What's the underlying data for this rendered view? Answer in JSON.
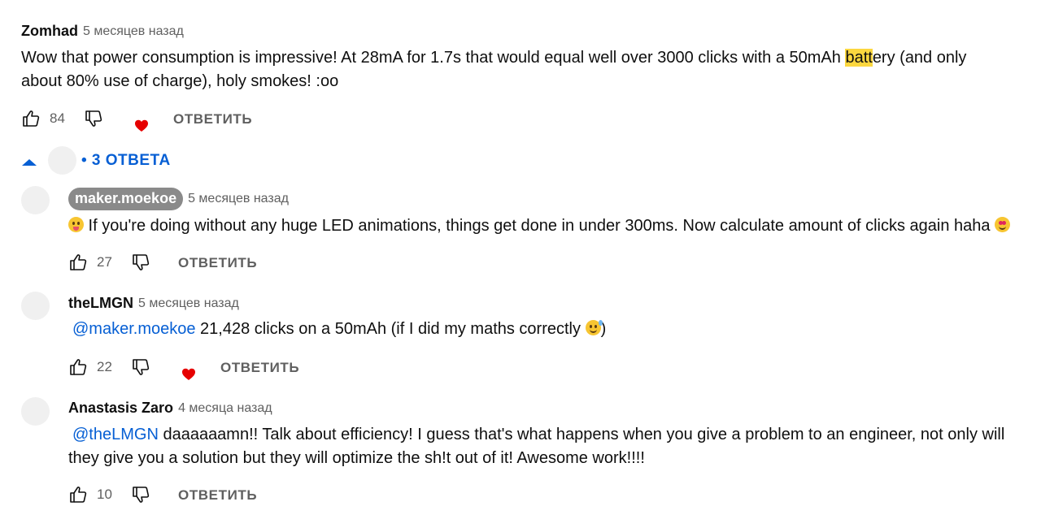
{
  "comments": [
    {
      "author": "Zomhad",
      "time": "5 месяцев назад",
      "text_pre": "Wow that power consumption is impressive! At 28mA for 1.7s that would equal well over 3000 clicks with a 50mAh ",
      "text_hl": "batt",
      "text_post": "ery (and only about 80% use of charge), holy smokes! :oo",
      "likes": "84",
      "reply_label": "ОТВЕТИТЬ",
      "creator_heart": true
    }
  ],
  "replies_toggle": {
    "label": "• 3 ОТВЕТА"
  },
  "replies": [
    {
      "author": "maker.moekoe",
      "time": "5 месяцев назад",
      "text": " If you're doing without any huge LED animations, things get done in under 300ms. Now calculate amount of clicks again haha ",
      "likes": "27",
      "reply_label": "ОТВЕТИТЬ"
    },
    {
      "author": "theLMGN",
      "time": "5 месяцев назад",
      "mention": "@maker.moekoe",
      "text": "  21,428 clicks on a 50mAh (if I did my maths correctly ",
      "text_end": ")",
      "likes": "22",
      "reply_label": "ОТВЕТИТЬ",
      "creator_heart": true
    },
    {
      "author": "Anastasis Zaro",
      "time": "4 месяца назад",
      "mention": "@theLMGN",
      "text": "  daaaaaamn!! Talk about efficiency! I guess that's what happens when you give a problem to an engineer, not only will they give you a solution but they will optimize the sh!t out of it! Awesome work!!!!",
      "likes": "10",
      "reply_label": "ОТВЕТИТЬ"
    }
  ],
  "icons": [
    "thumb-up-icon",
    "thumb-down-icon",
    "creator-heart-icon",
    "chevron-up-icon",
    "emoji-icon"
  ],
  "colors": {
    "link": "#065fd4",
    "highlight": "#fcd73f",
    "heart": "#e60000",
    "muted": "#606060",
    "chip": "#8a8a8a"
  }
}
